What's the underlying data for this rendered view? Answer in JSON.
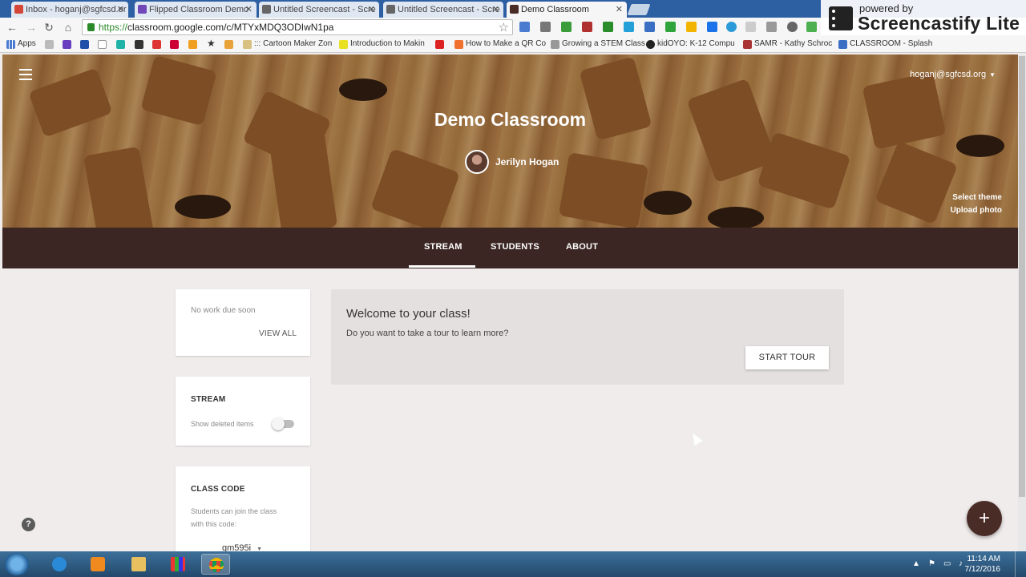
{
  "browser": {
    "tabs": [
      {
        "label": "Inbox - hoganj@sgfcsd.or",
        "color": "#d44638"
      },
      {
        "label": "Flipped Classroom Demo",
        "color": "#7248b9"
      },
      {
        "label": "Untitled Screencast - Scre",
        "color": "#444444"
      },
      {
        "label": "Untitled Screencast - Scre",
        "color": "#444444"
      },
      {
        "label": "Demo Classroom",
        "color": "#4a2c26"
      }
    ],
    "url_scheme": "https://",
    "url_rest": "classroom.google.com/c/MTYxMDQ3ODIwN1pa",
    "bookmarks": {
      "apps": "Apps",
      "cartoon": "::: Cartoon Maker Zon",
      "intro": "Introduction to Makin",
      "qr": "How to Make a QR Co",
      "stem": "Growing a STEM Class",
      "kidoyo": "kidOYO: K-12 Compu",
      "samr": "SAMR - Kathy Schroc",
      "classroom": "CLASSROOM - Splash"
    }
  },
  "overlay": {
    "powered_by": "powered by",
    "brand": "Screencastify Lite"
  },
  "header": {
    "account": "hoganj@sgfcsd.org",
    "class_title": "Demo Classroom",
    "teacher": "Jerilyn Hogan",
    "select_theme": "Select theme",
    "upload_photo": "Upload photo",
    "tabs": [
      "STREAM",
      "STUDENTS",
      "ABOUT"
    ]
  },
  "sidebar": {
    "upcoming": {
      "text": "No work due soon",
      "link": "VIEW ALL"
    },
    "stream": {
      "title": "STREAM",
      "toggle_label": "Show deleted items",
      "toggle_on": false
    },
    "class_code": {
      "title": "CLASS CODE",
      "desc_line1": "Students can join the class",
      "desc_line2": "with this code:",
      "code": "gm595i"
    }
  },
  "welcome": {
    "title": "Welcome to your class!",
    "subtitle": "Do you want to take a tour to learn more?",
    "button": "START TOUR"
  },
  "fab": {
    "symbol": "+"
  },
  "help": {
    "symbol": "?"
  },
  "taskbar": {
    "time": "11:14 AM",
    "date": "7/12/2016"
  },
  "colors": {
    "header_bar": "#3b2623",
    "fab": "#4a2c26",
    "page_bg": "#f0ecec"
  }
}
